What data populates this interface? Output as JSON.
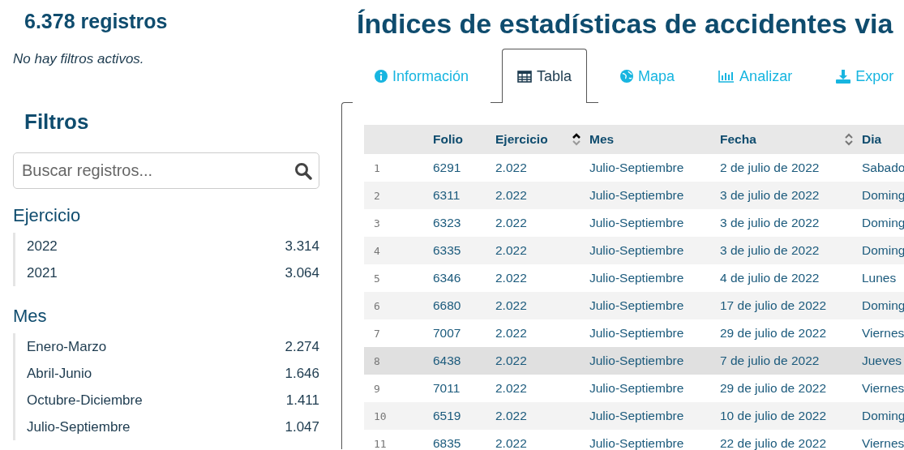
{
  "sidebar": {
    "record_count": "6.378 registros",
    "filter_status": "No hay filtros activos.",
    "filters_title": "Filtros",
    "search": {
      "placeholder": "Buscar registros..."
    },
    "groups": [
      {
        "title": "Ejercicio",
        "items": [
          {
            "label": "2022",
            "count": "3.314"
          },
          {
            "label": "2021",
            "count": "3.064"
          }
        ]
      },
      {
        "title": "Mes",
        "items": [
          {
            "label": "Enero-Marzo",
            "count": "2.274"
          },
          {
            "label": "Abril-Junio",
            "count": "1.646"
          },
          {
            "label": "Octubre-Diciembre",
            "count": "1.411"
          },
          {
            "label": "Julio-Septiembre",
            "count": "1.047"
          }
        ]
      }
    ]
  },
  "page_title": "Índices de estadísticas de accidentes via",
  "tabs": [
    {
      "label": "Información",
      "selected": false
    },
    {
      "label": "Tabla",
      "selected": true
    },
    {
      "label": "Mapa",
      "selected": false
    },
    {
      "label": "Analizar",
      "selected": false
    },
    {
      "label": "Expor",
      "selected": false
    }
  ],
  "table": {
    "columns": [
      {
        "label": "Folio",
        "sortable": false
      },
      {
        "label": "Ejercicio",
        "sortable": true,
        "sorted": true
      },
      {
        "label": "Mes",
        "sortable": false
      },
      {
        "label": "Fecha",
        "sortable": true,
        "sorted": false
      },
      {
        "label": "Dia"
      }
    ],
    "rows": [
      {
        "index": "1",
        "cells": [
          "6291",
          "2.022",
          "Julio-Septiembre",
          "2 de julio de 2022",
          "Sabado"
        ],
        "selected": false
      },
      {
        "index": "2",
        "cells": [
          "6311",
          "2.022",
          "Julio-Septiembre",
          "3 de julio de 2022",
          "Doming"
        ],
        "selected": false
      },
      {
        "index": "3",
        "cells": [
          "6323",
          "2.022",
          "Julio-Septiembre",
          "3 de julio de 2022",
          "Doming"
        ],
        "selected": false
      },
      {
        "index": "4",
        "cells": [
          "6335",
          "2.022",
          "Julio-Septiembre",
          "3 de julio de 2022",
          "Doming"
        ],
        "selected": false
      },
      {
        "index": "5",
        "cells": [
          "6346",
          "2.022",
          "Julio-Septiembre",
          "4 de julio de 2022",
          "Lunes"
        ],
        "selected": false
      },
      {
        "index": "6",
        "cells": [
          "6680",
          "2.022",
          "Julio-Septiembre",
          "17 de julio de 2022",
          "Doming"
        ],
        "selected": false
      },
      {
        "index": "7",
        "cells": [
          "7007",
          "2.022",
          "Julio-Septiembre",
          "29 de julio de 2022",
          "Viernes"
        ],
        "selected": false
      },
      {
        "index": "8",
        "cells": [
          "6438",
          "2.022",
          "Julio-Septiembre",
          "7 de julio de 2022",
          "Jueves"
        ],
        "selected": true
      },
      {
        "index": "9",
        "cells": [
          "7011",
          "2.022",
          "Julio-Septiembre",
          "29 de julio de 2022",
          "Viernes"
        ],
        "selected": false
      },
      {
        "index": "10",
        "cells": [
          "6519",
          "2.022",
          "Julio-Septiembre",
          "10 de julio de 2022",
          "Doming"
        ],
        "selected": false
      },
      {
        "index": "11",
        "cells": [
          "6835",
          "2.022",
          "Julio-Septiembre",
          "22 de julio de 2022",
          "Viernes"
        ],
        "selected": false
      }
    ]
  }
}
